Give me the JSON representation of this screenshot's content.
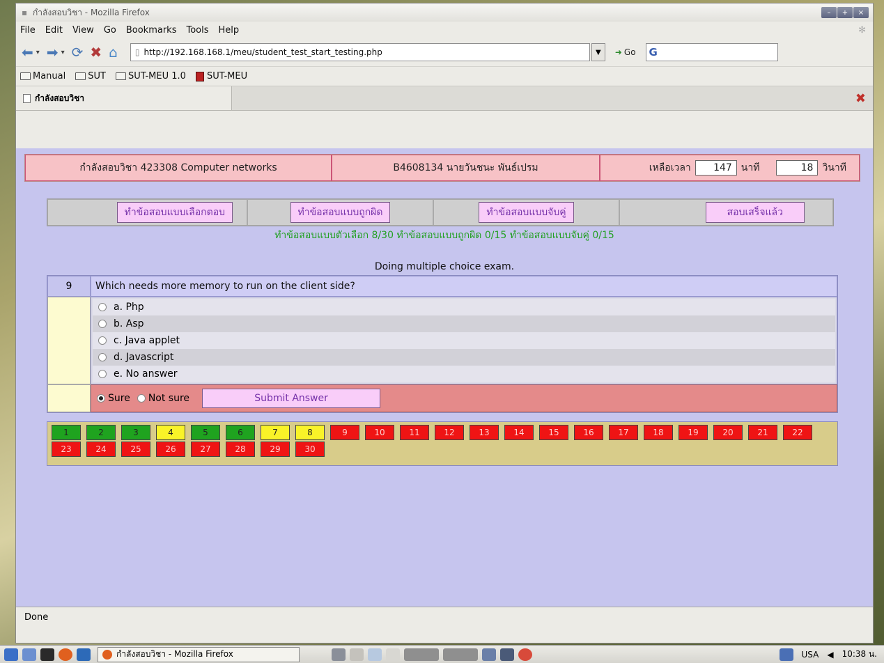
{
  "window": {
    "title": "กำลังสอบวิชา - Mozilla Firefox"
  },
  "menu": [
    "File",
    "Edit",
    "View",
    "Go",
    "Bookmarks",
    "Tools",
    "Help"
  ],
  "navbar": {
    "url": "http://192.168.168.1/meu/student_test_start_testing.php",
    "go_label": "Go",
    "search_label": "G"
  },
  "bookmarks": [
    "Manual",
    "SUT",
    "SUT-MEU 1.0",
    "SUT-MEU"
  ],
  "tab": {
    "title": "กำลังสอบวิชา"
  },
  "page": {
    "subject": "กำลังสอบวิชา 423308 Computer networks",
    "student": "B4608134 นายวันชนะ  พันธ์เปรม",
    "time_left_label": "เหลือเวลา",
    "minutes": "147",
    "minutes_unit": "นาที",
    "seconds": "18",
    "seconds_unit": "วินาที",
    "buttons": [
      "ทำข้อสอบแบบเลือกตอบ",
      "ทำข้อสอบแบบถูกผิด",
      "ทำข้อสอบแบบจับคู่",
      "สอบเสร็จแล้ว"
    ],
    "progress": "ทำข้อสอบแบบตัวเลือก 8/30 ทำข้อสอบแบบถูกผิด 0/15 ทำข้อสอบแบบจับคู่ 0/15",
    "mode": "Doing multiple choice exam.",
    "question": {
      "number": "9",
      "text": "Which needs more memory to run on the client side?",
      "options": [
        "a. Php",
        "b. Asp",
        "c. Java applet",
        "d. Javascript",
        "e. No answer"
      ]
    },
    "sure_label": "Sure",
    "not_sure_label": "Not sure",
    "submit_label": "Submit Answer",
    "question_grid": [
      {
        "n": "1",
        "status": "green"
      },
      {
        "n": "2",
        "status": "green"
      },
      {
        "n": "3",
        "status": "green"
      },
      {
        "n": "4",
        "status": "yellow"
      },
      {
        "n": "5",
        "status": "green"
      },
      {
        "n": "6",
        "status": "green"
      },
      {
        "n": "7",
        "status": "yellow"
      },
      {
        "n": "8",
        "status": "yellow"
      },
      {
        "n": "9",
        "status": "red"
      },
      {
        "n": "10",
        "status": "red"
      },
      {
        "n": "11",
        "status": "red"
      },
      {
        "n": "12",
        "status": "red"
      },
      {
        "n": "13",
        "status": "red"
      },
      {
        "n": "14",
        "status": "red"
      },
      {
        "n": "15",
        "status": "red"
      },
      {
        "n": "16",
        "status": "red"
      },
      {
        "n": "17",
        "status": "red"
      },
      {
        "n": "18",
        "status": "red"
      },
      {
        "n": "19",
        "status": "red"
      },
      {
        "n": "20",
        "status": "red"
      },
      {
        "n": "21",
        "status": "red"
      },
      {
        "n": "22",
        "status": "red"
      },
      {
        "n": "23",
        "status": "red"
      },
      {
        "n": "24",
        "status": "red"
      },
      {
        "n": "25",
        "status": "red"
      },
      {
        "n": "26",
        "status": "red"
      },
      {
        "n": "27",
        "status": "red"
      },
      {
        "n": "28",
        "status": "red"
      },
      {
        "n": "29",
        "status": "red"
      },
      {
        "n": "30",
        "status": "red"
      }
    ]
  },
  "status": "Done",
  "taskbar": {
    "task_label": "กำลังสอบวิชา - Mozilla Firefox",
    "keyboard": "USA",
    "clock": "10:38 น."
  }
}
